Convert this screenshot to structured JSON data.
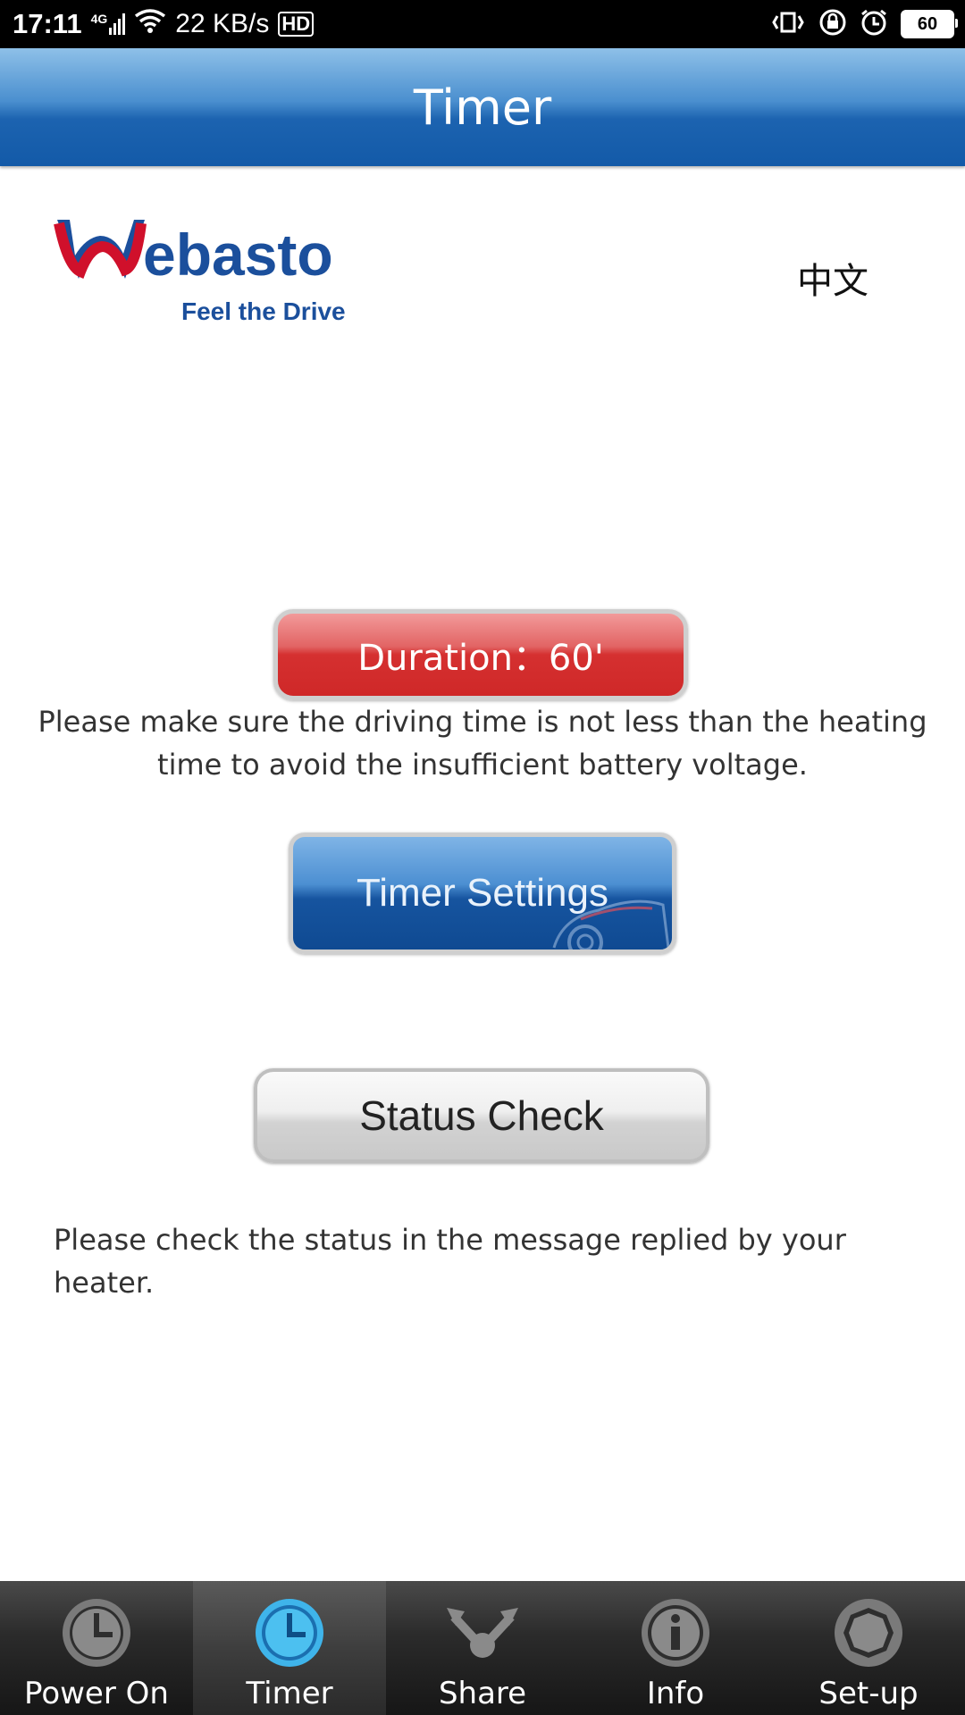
{
  "status_bar": {
    "time": "17:11",
    "network": "4G",
    "speed": "22 KB/s",
    "hd": "HD",
    "battery": "60"
  },
  "header": {
    "title": "Timer"
  },
  "logo": {
    "brand": "Webasto",
    "tagline": "Feel the Drive"
  },
  "language_toggle": "中文",
  "duration_button": {
    "label": "Duration：60'"
  },
  "notes": {
    "driving_time": "Please make sure the driving time is not less than the heating time to avoid the insufficient battery voltage.",
    "status": "Please check the status in the message replied by your heater."
  },
  "timer_settings_button": {
    "label": "Timer Settings"
  },
  "status_check_button": {
    "label": "Status Check"
  },
  "tabs": [
    {
      "label": "Power On",
      "icon": "power-on-icon",
      "active": false
    },
    {
      "label": "Timer",
      "icon": "timer-icon",
      "active": true
    },
    {
      "label": "Share",
      "icon": "share-icon",
      "active": false
    },
    {
      "label": "Info",
      "icon": "info-icon",
      "active": false
    },
    {
      "label": "Set-up",
      "icon": "setup-icon",
      "active": false
    }
  ],
  "colors": {
    "header_blue": "#135aa8",
    "duration_red": "#d53030",
    "active_tab_accent": "#3fb4ea",
    "brand_red": "#d0102b",
    "brand_blue": "#1b4f9c"
  }
}
